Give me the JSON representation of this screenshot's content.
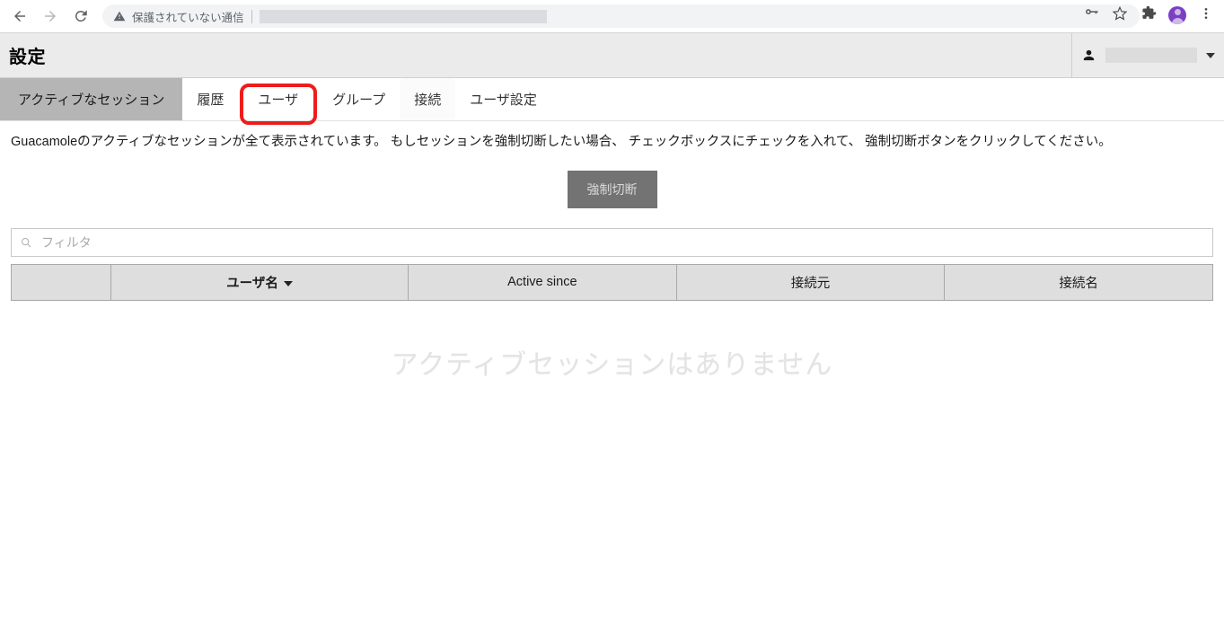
{
  "browser": {
    "back_icon": "arrow-left-icon",
    "forward_icon": "arrow-right-icon",
    "reload_icon": "reload-icon",
    "security_warning": "保護されていない通信",
    "url_value": "",
    "toolbar_icons": [
      "key-icon",
      "star-icon",
      "puzzle-icon",
      "avatar-icon",
      "kebab-menu-icon"
    ]
  },
  "app": {
    "title": "設定",
    "user_menu": {
      "user_icon": "person-icon",
      "username": "",
      "caret": "chevron-down-icon"
    }
  },
  "tabs": [
    {
      "label": "アクティブなセッション",
      "state": "active"
    },
    {
      "label": "履歴",
      "state": "default"
    },
    {
      "label": "ユーザ",
      "state": "annotated"
    },
    {
      "label": "グループ",
      "state": "default"
    },
    {
      "label": "接続",
      "state": "hover"
    },
    {
      "label": "ユーザ設定",
      "state": "default"
    }
  ],
  "annotation": {
    "color": "#ee1c1c",
    "target": "ユーザ"
  },
  "main": {
    "description": "Guacamoleのアクティブなセッションが全て表示されています。 もしセッションを強制切断したい場合、 チェックボックスにチェックを入れて、 強制切断ボタンをクリックしてください。",
    "disconnect_button": {
      "label": "強制切断",
      "enabled": false,
      "bg_color": "#737373",
      "text_color": "#d9d9d9"
    },
    "filter": {
      "placeholder": "フィルタ",
      "value": "",
      "icon": "search-icon"
    },
    "table": {
      "columns": [
        {
          "label": "",
          "key": "checkbox"
        },
        {
          "label": "ユーザ名",
          "key": "username",
          "sorted": true,
          "sort_direction": "desc"
        },
        {
          "label": "Active since",
          "key": "active_since"
        },
        {
          "label": "接続元",
          "key": "remote_host"
        },
        {
          "label": "接続名",
          "key": "connection_name"
        }
      ],
      "rows": []
    },
    "empty_message": "アクティブセッションはありません"
  }
}
